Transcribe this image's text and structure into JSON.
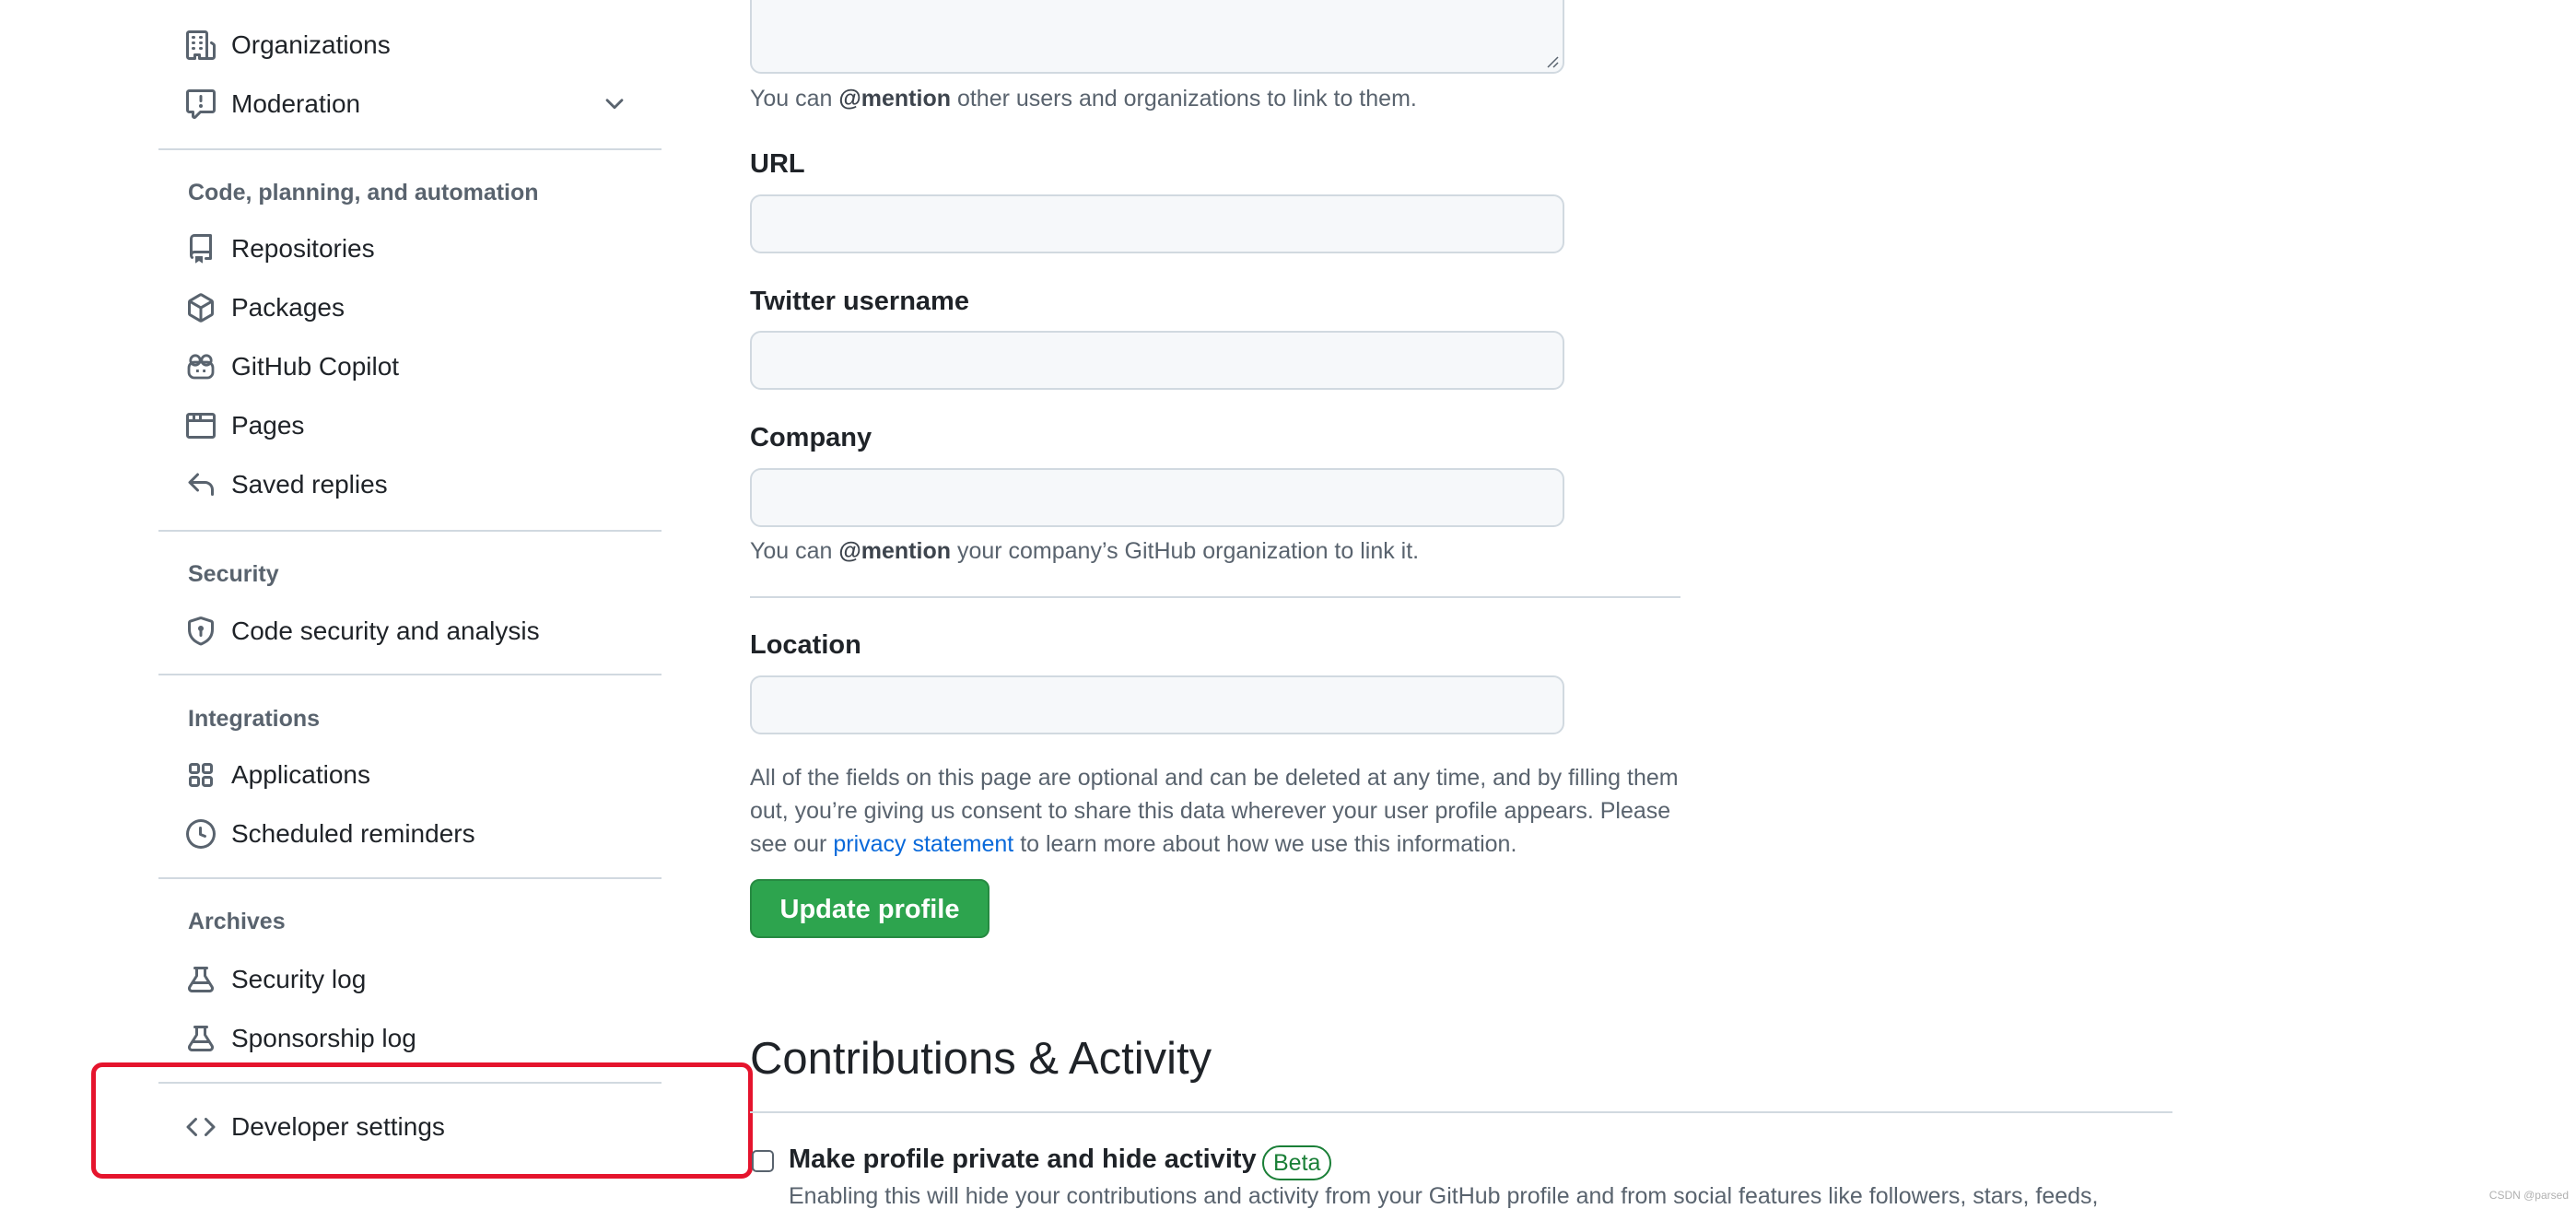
{
  "sidebar": {
    "items": {
      "organizations": {
        "label": "Organizations",
        "icon": "organization-icon"
      },
      "moderation": {
        "label": "Moderation",
        "icon": "report-icon"
      },
      "repositories": {
        "label": "Repositories",
        "icon": "repo-icon"
      },
      "packages": {
        "label": "Packages",
        "icon": "package-icon"
      },
      "copilot": {
        "label": "GitHub Copilot",
        "icon": "copilot-icon"
      },
      "pages": {
        "label": "Pages",
        "icon": "browser-icon"
      },
      "saved_replies": {
        "label": "Saved replies",
        "icon": "reply-icon"
      },
      "code_security": {
        "label": "Code security and analysis",
        "icon": "shield-lock-icon"
      },
      "applications": {
        "label": "Applications",
        "icon": "apps-icon"
      },
      "scheduled_reminders": {
        "label": "Scheduled reminders",
        "icon": "clock-icon"
      },
      "security_log": {
        "label": "Security log",
        "icon": "log-icon"
      },
      "sponsorship_log": {
        "label": "Sponsorship log",
        "icon": "log-icon"
      },
      "developer_settings": {
        "label": "Developer settings",
        "icon": "code-icon"
      }
    },
    "sections": {
      "code_planning": "Code, planning, and automation",
      "security": "Security",
      "integrations": "Integrations",
      "archives": "Archives"
    }
  },
  "form": {
    "bio_note": {
      "prefix": "You can ",
      "mention": "@mention",
      "suffix": " other users and organizations to link to them."
    },
    "url": {
      "label": "URL",
      "value": ""
    },
    "twitter": {
      "label": "Twitter username",
      "value": ""
    },
    "company": {
      "label": "Company",
      "value": "",
      "note_prefix": "You can ",
      "note_mention": "@mention",
      "note_suffix": " your company’s GitHub organization to link it."
    },
    "location": {
      "label": "Location",
      "value": ""
    },
    "consent": {
      "before_link": "All of the fields on this page are optional and can be deleted at any time, and by filling them out, you’re giving us consent to share this data wherever your user profile appears. Please see our ",
      "link": "privacy statement",
      "after_link": " to learn more about how we use this information."
    },
    "update_button": "Update profile"
  },
  "contributions": {
    "heading": "Contributions & Activity",
    "private_label": "Make profile private and hide activity",
    "private_checked": false,
    "badge": "Beta",
    "description": "Enabling this will hide your contributions and activity from your GitHub profile and from social features like followers, stars, feeds,"
  },
  "watermark": "CSDN @parsed",
  "colors": {
    "primary_button": "#2da44e",
    "link": "#0969da",
    "highlight": "#e5142d",
    "beta": "#1a7f37"
  }
}
